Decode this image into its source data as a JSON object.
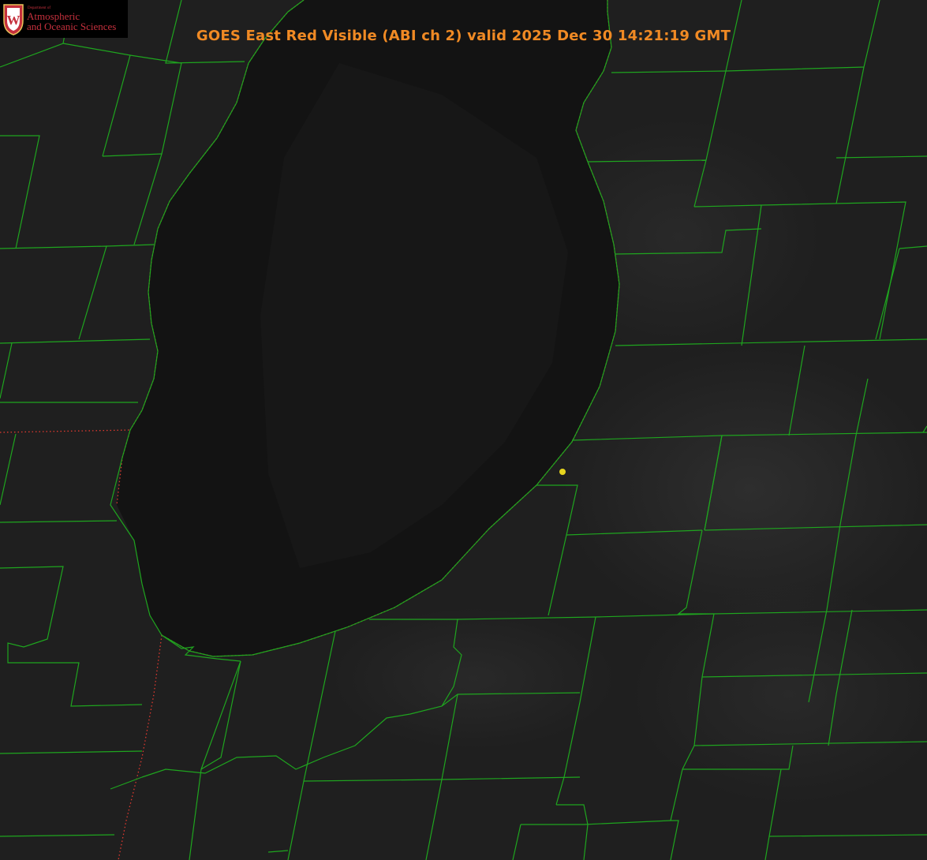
{
  "title": "GOES East Red Visible (ABI ch 2) valid 2025 Dec 30 14:21:19 GMT",
  "logo": {
    "dept": "Department of",
    "line1": "Atmospheric",
    "line2": "and Oceanic Sciences",
    "crest_letter": "W"
  },
  "colors": {
    "title": "#f08a24",
    "county_lines": "#1fa51f",
    "state_lines": "#e0392f",
    "marker": "#e6d41e",
    "lake": "#121212",
    "land": "#1f1f1f",
    "logo_text": "#c5303d"
  },
  "markers": [
    {
      "name": "station-point",
      "shape": "dot"
    }
  ]
}
